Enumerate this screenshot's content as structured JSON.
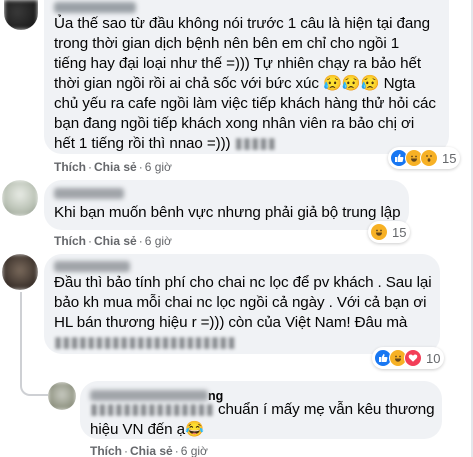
{
  "comments": [
    {
      "lines": [
        "Ủa thế sao từ đầu không nói trước 1 câu là hiện tại đang",
        "trong thời gian dịch bệnh nên bên em chỉ cho ngồi 1",
        "tiếng hay đại loại như thế =))) Tự nhiên chạy ra bảo hết",
        "thời gian ngồi rồi ai chả sốc với bức xúc 😥😥😥 Ngta",
        "chủ yếu ra cafe ngồi làm việc tiếp khách hàng thử hỏi các",
        "bạn đang ngồi tiếp khách xong nhân viên ra bảo chị ơi",
        "hết 1 tiếng rồi thì nnao =)))"
      ],
      "like_label": "Thích",
      "share_label": "Chia sẻ",
      "time": "6 giờ",
      "reaction_count": "15"
    },
    {
      "lines": [
        "Khi bạn muốn bênh vực nhưng phải giả bộ trung lập"
      ],
      "like_label": "Thích",
      "share_label": "Chia sẻ",
      "time": "6 giờ",
      "reaction_count": "15"
    },
    {
      "lines": [
        "Đầu thì bảo tính phí cho chai nc lọc để pv khách . Sau lại",
        "bảo kh mua mỗi chai nc lọc ngồi cả ngày . Với cả bạn ơi",
        "HL bán thương hiệu r =))) còn của Việt Nam! Đâu mà"
      ],
      "like_label": "Thích",
      "share_label": "Chia sẻ",
      "time": "6 giờ",
      "reaction_count": "10"
    },
    {
      "name_visible": "ng",
      "lines": [
        "chuẩn í mấy mẹ vẫn kêu thương",
        "hiệu VN đến ạ😂"
      ],
      "like_label": "Thích",
      "share_label": "Chia sẻ",
      "time": "6 giờ"
    }
  ],
  "colors": {
    "bubble": "#f0f2f5",
    "text": "#050505",
    "secondary": "#65676b",
    "like_blue": "#1877f2",
    "love_red": "#f33e58",
    "haha_yellow": "#f7b125"
  },
  "icons": {
    "like": "like-icon",
    "haha": "haha-icon",
    "wow": "wow-icon",
    "love": "love-icon"
  }
}
